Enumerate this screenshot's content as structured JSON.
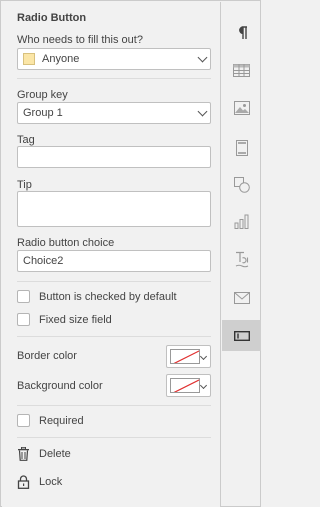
{
  "panel": {
    "title": "Radio Button",
    "who_label": "Who needs to fill this out?",
    "who_value": "Anyone",
    "group_label": "Group key",
    "group_value": "Group 1",
    "tag_label": "Tag",
    "tag_value": "",
    "tip_label": "Tip",
    "tip_value": "",
    "choice_label": "Radio button choice",
    "choice_value": "Choice2",
    "checked_default": "Button is checked by default",
    "fixed_size": "Fixed size field",
    "border_color": "Border color",
    "background_color": "Background color",
    "required": "Required",
    "delete": "Delete",
    "lock": "Lock"
  },
  "colors": {
    "anyone_swatch": "#fbe6a7",
    "no_color_line": "#e03030",
    "active_tool_bg": "#cfcfcf"
  },
  "toolbar": {
    "items": [
      "paragraph-icon",
      "table-icon",
      "image-icon",
      "header-footer-icon",
      "shape-icon",
      "chart-icon",
      "text-art-icon",
      "mail-merge-icon",
      "form-field-icon"
    ],
    "active": "form-field-icon"
  }
}
